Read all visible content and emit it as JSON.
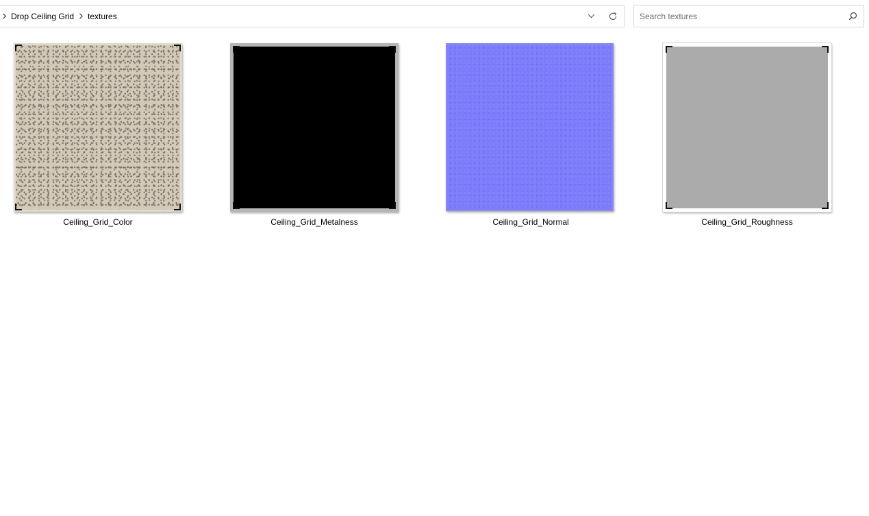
{
  "breadcrumb": {
    "items": [
      "Drop Ceiling Grid",
      "textures"
    ]
  },
  "search": {
    "placeholder": "Search textures",
    "value": ""
  },
  "files": [
    {
      "name": "Ceiling_Grid_Color",
      "thumbnail_color": "#d2c9b8"
    },
    {
      "name": "Ceiling_Grid_Metalness",
      "thumbnail_color": "#000000"
    },
    {
      "name": "Ceiling_Grid_Normal",
      "thumbnail_color": "#7d7dfb"
    },
    {
      "name": "Ceiling_Grid_Roughness",
      "thumbnail_color": "#ababab"
    }
  ],
  "icons": {
    "breadcrumb_separator": "chevron-right-icon",
    "history_dropdown": "chevron-down-icon",
    "refresh": "refresh-icon",
    "search": "search-icon"
  }
}
